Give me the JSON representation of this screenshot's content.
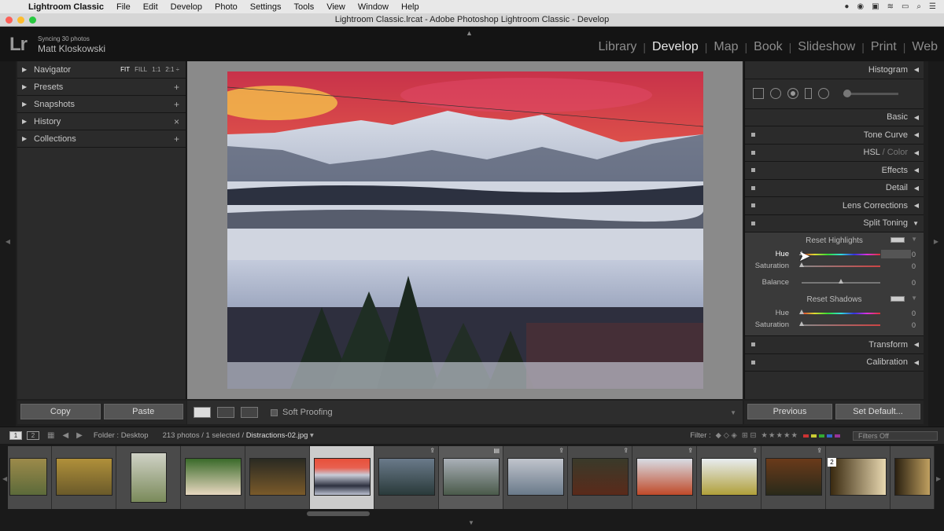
{
  "menubar": {
    "app": "Lightroom Classic",
    "items": [
      "File",
      "Edit",
      "Develop",
      "Photo",
      "Settings",
      "Tools",
      "View",
      "Window",
      "Help"
    ]
  },
  "window": {
    "title": "Lightroom Classic.lrcat - Adobe Photoshop Lightroom Classic - Develop"
  },
  "identity": {
    "logo": "Lr",
    "sync": "Syncing 30 photos",
    "user": "Matt Kloskowski"
  },
  "modules": [
    "Library",
    "Develop",
    "Map",
    "Book",
    "Slideshow",
    "Print",
    "Web"
  ],
  "active_module": "Develop",
  "left_panel": {
    "sections": [
      {
        "label": "Navigator",
        "extra": [
          "FIT",
          "FILL",
          "1:1",
          "2:1 ÷"
        ]
      },
      {
        "label": "Presets",
        "extra": [
          "+"
        ]
      },
      {
        "label": "Snapshots",
        "extra": [
          "+"
        ]
      },
      {
        "label": "History",
        "extra": [
          "×"
        ]
      },
      {
        "label": "Collections",
        "extra": [
          "+"
        ]
      }
    ],
    "copy": "Copy",
    "paste": "Paste"
  },
  "toolbar": {
    "soft_proofing": "Soft Proofing"
  },
  "right_panel": {
    "histogram": "Histogram",
    "basic": "Basic",
    "tone_curve": "Tone Curve",
    "hsl": "HSL",
    "hsl_sep": " / ",
    "color": "Color",
    "effects": "Effects",
    "detail": "Detail",
    "lens": "Lens Corrections",
    "split": "Split Toning",
    "reset_highlights": "Reset Highlights",
    "hue": "Hue",
    "saturation": "Saturation",
    "balance": "Balance",
    "reset_shadows": "Reset Shadows",
    "transform": "Transform",
    "calibration": "Calibration",
    "values": {
      "hl_hue": "0",
      "hl_sat": "0",
      "balance": "0",
      "sh_hue": "0",
      "sh_sat": "0"
    },
    "previous": "Previous",
    "set_default": "Set Default..."
  },
  "filmbar": {
    "pages": [
      "1",
      "2"
    ],
    "folder": "Folder : Desktop",
    "count": "213 photos / 1 selected /",
    "file": "Distractions-02.jpg",
    "filter_label": "Filter :",
    "stars": "★★★★★",
    "filters_off": "Filters Off"
  },
  "filmstrip": {
    "stack_number": "2"
  }
}
